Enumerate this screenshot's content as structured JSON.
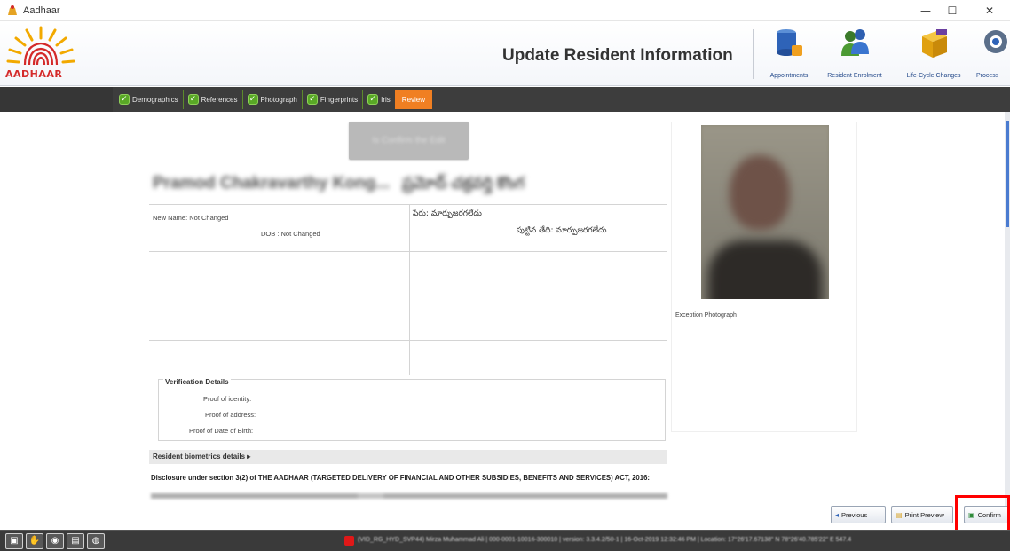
{
  "window": {
    "title": "Aadhaar",
    "minimize": "—",
    "maximize": "☐",
    "close": "✕"
  },
  "header": {
    "logo_text": "AADHAAR",
    "page_title": "Update Resident Information",
    "tools": [
      {
        "label": "Appointments",
        "icon": "database-icon"
      },
      {
        "label": "Resident Enrolment",
        "icon": "users-icon"
      },
      {
        "label": "Life-Cycle Changes",
        "icon": "box-icon"
      },
      {
        "label": "Process",
        "icon": "gear-icon"
      }
    ]
  },
  "tabs": [
    {
      "label": "Demographics",
      "checked": true
    },
    {
      "label": "References",
      "checked": true
    },
    {
      "label": "Photograph",
      "checked": true
    },
    {
      "label": "Fingerprints",
      "checked": true
    },
    {
      "label": "Iris",
      "checked": true
    },
    {
      "label": "Review",
      "checked": false,
      "active": true
    }
  ],
  "review": {
    "gray_button": "Is Confirm the Edit",
    "resident_name": "Pramod Chakravarthy Kong...",
    "resident_name_local": "ప్రమోద్ చక్రవర్తి కొంగ",
    "new_name": "New Name: Not Changed",
    "dob": "DOB : Not Changed",
    "name_local": "పేరు: మార్పుజరగలేదు",
    "dob_local": "పుట్టిన తేది: మార్పుజరగలేదు",
    "photo_caption": "Exception Photograph",
    "verification": {
      "title": "Verification Details",
      "fields": [
        "Proof of identity:",
        "Proof of address:",
        "Proof of Date of Birth:"
      ]
    },
    "biometrics_label": "Resident biometrics details ▸",
    "disclosure": "Disclosure under section 3(2) of THE AADHAAR (TARGETED DELIVERY OF FINANCIAL AND OTHER SUBSIDIES, BENEFITS AND SERVICES) ACT, 2016:"
  },
  "nav_buttons": {
    "previous": "Previous",
    "print_preview": "Print Preview",
    "confirm": "Confirm"
  },
  "status": {
    "text": "(VID_RG_HYD_SVP44) Mirza Muhammad Ali | 000-0001-10016-300010 | version: 3.3.4.2/50-1 | 16-Oct-2019 12:32:46 PM | Location: 17°26'17.67138\" N 78°26'40.785'22\" E 547.4"
  }
}
